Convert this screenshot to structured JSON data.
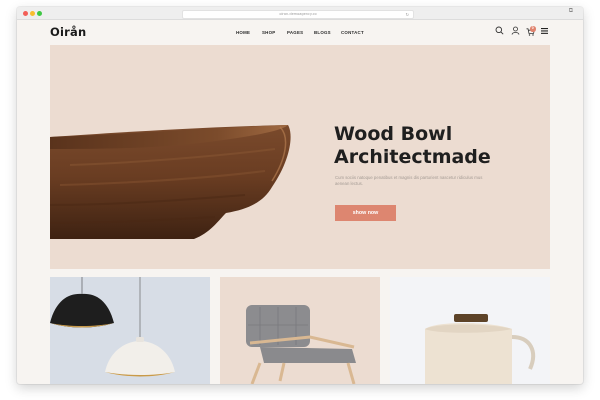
{
  "browser": {
    "url": "oiran.demoagency.co"
  },
  "header": {
    "logo": "Oirån",
    "nav": [
      {
        "label": "HOME"
      },
      {
        "label": "SHOP"
      },
      {
        "label": "PAGES"
      },
      {
        "label": "BLOGS"
      },
      {
        "label": "CONTACT"
      }
    ],
    "cart_count": "0",
    "icons": [
      "search-icon",
      "user-icon",
      "cart-icon",
      "menu-icon"
    ]
  },
  "hero": {
    "title_line1": "Wood Bowl",
    "title_line2": "Architectmade",
    "description": "Cum sociis natoque penatibus et magnis dis parturient nascetur ridiculus mus aenean lectus.",
    "button_label": "show now"
  },
  "tiles": [
    {
      "name": "pendant-lamps"
    },
    {
      "name": "armchair"
    },
    {
      "name": "teapot"
    }
  ],
  "colors": {
    "accent": "#dd8670",
    "hero_bg": "#ecdcd1",
    "page_bg": "#f7f4f1",
    "text_dark": "#1f1f1f"
  }
}
